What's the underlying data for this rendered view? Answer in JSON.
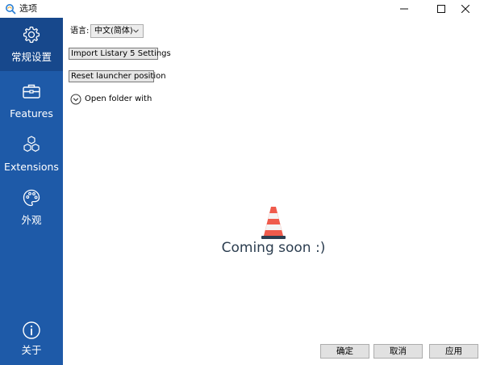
{
  "window": {
    "title": "选项",
    "controls": [
      "minimize-icon",
      "maximize-icon",
      "close-icon"
    ]
  },
  "sidebar": {
    "items": [
      {
        "label": "常规设置",
        "icon": "gear-icon",
        "active": true
      },
      {
        "label": "Features",
        "icon": "toolbox-icon",
        "active": false
      },
      {
        "label": "Extensions",
        "icon": "cubes-icon",
        "active": false
      },
      {
        "label": "外观",
        "icon": "palette-icon",
        "active": false
      },
      {
        "label": "关于",
        "icon": "info-icon",
        "active": false
      }
    ]
  },
  "general": {
    "language_label": "语言:",
    "language_value": "中文(简体)",
    "import_button": "Import Listary 5 Settings",
    "reset_button": "Reset launcher position",
    "open_folder_label": "Open folder with",
    "coming_soon": "Coming soon :)"
  },
  "footer": {
    "ok": "确定",
    "cancel": "取消",
    "apply": "应用"
  },
  "colors": {
    "sidebar": "#1e5aa8",
    "sidebar_active": "#17488c",
    "cone_orange": "#ef5b4c",
    "coming_text": "#2c3e50"
  }
}
